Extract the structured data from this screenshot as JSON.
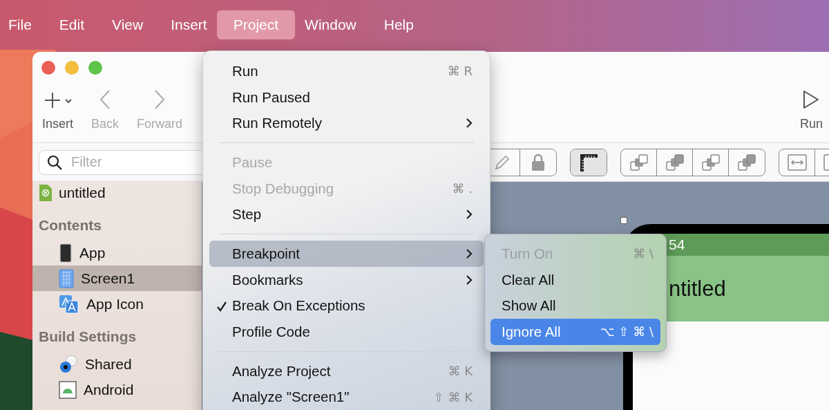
{
  "menubar": {
    "items": [
      {
        "label": "File",
        "selected": false
      },
      {
        "label": "Edit",
        "selected": false
      },
      {
        "label": "View",
        "selected": false
      },
      {
        "label": "Insert",
        "selected": false
      },
      {
        "label": "Project",
        "selected": true
      },
      {
        "label": "Window",
        "selected": false
      },
      {
        "label": "Help",
        "selected": false
      }
    ]
  },
  "toolbar": {
    "buttons": [
      {
        "label": "Insert",
        "disabled": false
      },
      {
        "label": "Back",
        "disabled": true
      },
      {
        "label": "Forward",
        "disabled": true
      }
    ],
    "run_button": {
      "label": "Run"
    }
  },
  "filter": {
    "placeholder": "Filter"
  },
  "sidebar": {
    "items": [
      {
        "kind": "document",
        "label": "untitled",
        "selected": false
      },
      {
        "kind": "header",
        "label": "Contents"
      },
      {
        "kind": "item",
        "label": "App",
        "selected": false
      },
      {
        "kind": "item",
        "label": "Screen1",
        "selected": true
      },
      {
        "kind": "item",
        "label": "App Icon",
        "selected": false
      },
      {
        "kind": "header",
        "label": "Build Settings"
      },
      {
        "kind": "item",
        "label": "Shared",
        "selected": false
      },
      {
        "kind": "item",
        "label": "Android",
        "selected": false
      }
    ]
  },
  "tool_groups": [
    {
      "buttons": [
        {
          "selected": false
        },
        {
          "selected": false
        }
      ]
    },
    {
      "buttons": [
        {
          "selected": true
        }
      ]
    },
    {
      "buttons": [
        {
          "selected": false
        },
        {
          "selected": false
        },
        {
          "selected": false
        },
        {
          "selected": false
        }
      ]
    },
    {
      "buttons": [
        {
          "selected": false
        },
        {
          "selected": false
        }
      ]
    }
  ],
  "phone": {
    "status_time": "54",
    "title": "ntitled"
  },
  "menu": {
    "items": [
      {
        "kind": "item",
        "label": "Run",
        "shortcut": "⌘ R",
        "disabled": false,
        "checked": false,
        "submenu": false,
        "selected": false
      },
      {
        "kind": "item",
        "label": "Run Paused",
        "disabled": false,
        "checked": false,
        "submenu": false,
        "selected": false
      },
      {
        "kind": "item",
        "label": "Run Remotely",
        "disabled": false,
        "checked": false,
        "submenu": true,
        "selected": false
      },
      {
        "kind": "separator"
      },
      {
        "kind": "item",
        "label": "Pause",
        "disabled": true,
        "checked": false,
        "submenu": false,
        "selected": false
      },
      {
        "kind": "item",
        "label": "Stop Debugging",
        "shortcut": "⌘ .",
        "disabled": true,
        "checked": false,
        "submenu": false,
        "selected": false
      },
      {
        "kind": "item",
        "label": "Step",
        "disabled": false,
        "checked": false,
        "submenu": true,
        "selected": false
      },
      {
        "kind": "separator"
      },
      {
        "kind": "item",
        "label": "Breakpoint",
        "disabled": false,
        "checked": false,
        "submenu": true,
        "selected": true
      },
      {
        "kind": "item",
        "label": "Bookmarks",
        "disabled": false,
        "checked": false,
        "submenu": true,
        "selected": false
      },
      {
        "kind": "item",
        "label": "Break On Exceptions",
        "disabled": false,
        "checked": true,
        "submenu": false,
        "selected": false
      },
      {
        "kind": "item",
        "label": "Profile Code",
        "disabled": false,
        "checked": false,
        "submenu": false,
        "selected": false
      },
      {
        "kind": "separator"
      },
      {
        "kind": "item",
        "label": "Analyze Project",
        "shortcut": "⌘ K",
        "disabled": false,
        "checked": false,
        "submenu": false,
        "selected": false
      },
      {
        "kind": "item",
        "label": "Analyze \"Screen1\"",
        "shortcut": "⇧ ⌘ K",
        "disabled": false,
        "checked": false,
        "submenu": false,
        "selected": false
      }
    ]
  },
  "submenu": {
    "items": [
      {
        "label": "Turn On",
        "shortcut": "⌘ \\",
        "disabled": true,
        "selected": false
      },
      {
        "label": "Clear All",
        "disabled": false,
        "selected": false
      },
      {
        "label": "Show All",
        "disabled": false,
        "selected": false
      },
      {
        "label": "Ignore All",
        "shortcut": "⌥ ⇧ ⌘ \\",
        "disabled": false,
        "selected": true
      }
    ]
  }
}
